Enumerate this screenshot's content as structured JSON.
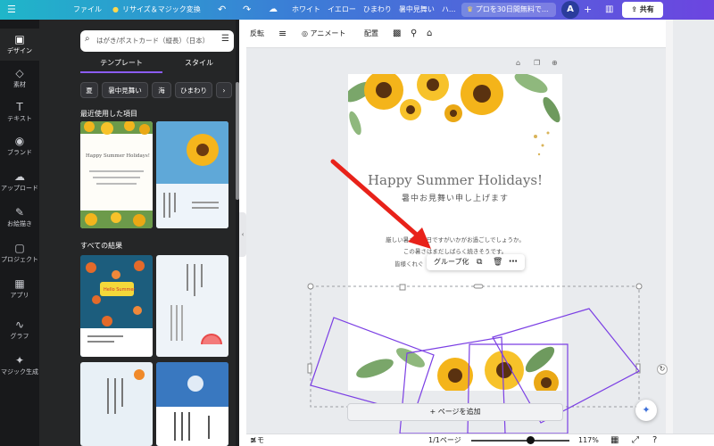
{
  "topbar": {
    "file": "ファイル",
    "resize": "リサイズ＆マジック変換",
    "title": "ホワイト　イエロー　ひまわり　暑中見舞い　ハ...",
    "pro_trial": "プロを30日間無料で...",
    "avatar": "A",
    "share": "共有",
    "menu_icon": "hamburger-icon",
    "undo_icon": "undo-icon",
    "redo_icon": "redo-icon",
    "cloud_icon": "cloud-icon",
    "accent": "#8b5cf6"
  },
  "rail": {
    "items": [
      {
        "label": "デザイン",
        "icon": "▣"
      },
      {
        "label": "素材",
        "icon": "◇"
      },
      {
        "label": "テキスト",
        "icon": "T"
      },
      {
        "label": "ブランド",
        "icon": "◉"
      },
      {
        "label": "アップロード",
        "icon": "☁"
      },
      {
        "label": "お絵描き",
        "icon": "✎"
      },
      {
        "label": "プロジェクト",
        "icon": "▢"
      },
      {
        "label": "アプリ",
        "icon": "▦"
      },
      {
        "label": "グラフ",
        "icon": "∿"
      },
      {
        "label": "マジック生成",
        "icon": "✦"
      }
    ]
  },
  "panel": {
    "search_placeholder": "はがき/ポストカード（縦長）（日本）",
    "tabs": [
      "テンプレート",
      "スタイル"
    ],
    "chips": [
      "夏",
      "暑中見舞い",
      "海",
      "ひまわり",
      "›"
    ],
    "recent_title": "最近使用した項目",
    "all_results_title": "すべての結果",
    "thumb1_title": "Happy Summer Holidays!",
    "thumb3_title": "Hello Summer"
  },
  "toolbar": {
    "flip": "反転",
    "animate": "アニメート",
    "position": "配置"
  },
  "canvas": {
    "headline": "Happy Summer Holidays!",
    "subhead": "暑中お見舞い申し上げます",
    "body_line1": "厳しい暑さが毎日ですがいかがお過ごしでしょうか。",
    "body_line2": "この暑さはまだしばらく続きそうです。",
    "body_line3": "皆様くれぐ",
    "group_label": "グループ化",
    "add_page": "+ ページを追加"
  },
  "bottombar": {
    "memo": "メモ",
    "page": "1/1ページ",
    "zoom": "117%"
  }
}
